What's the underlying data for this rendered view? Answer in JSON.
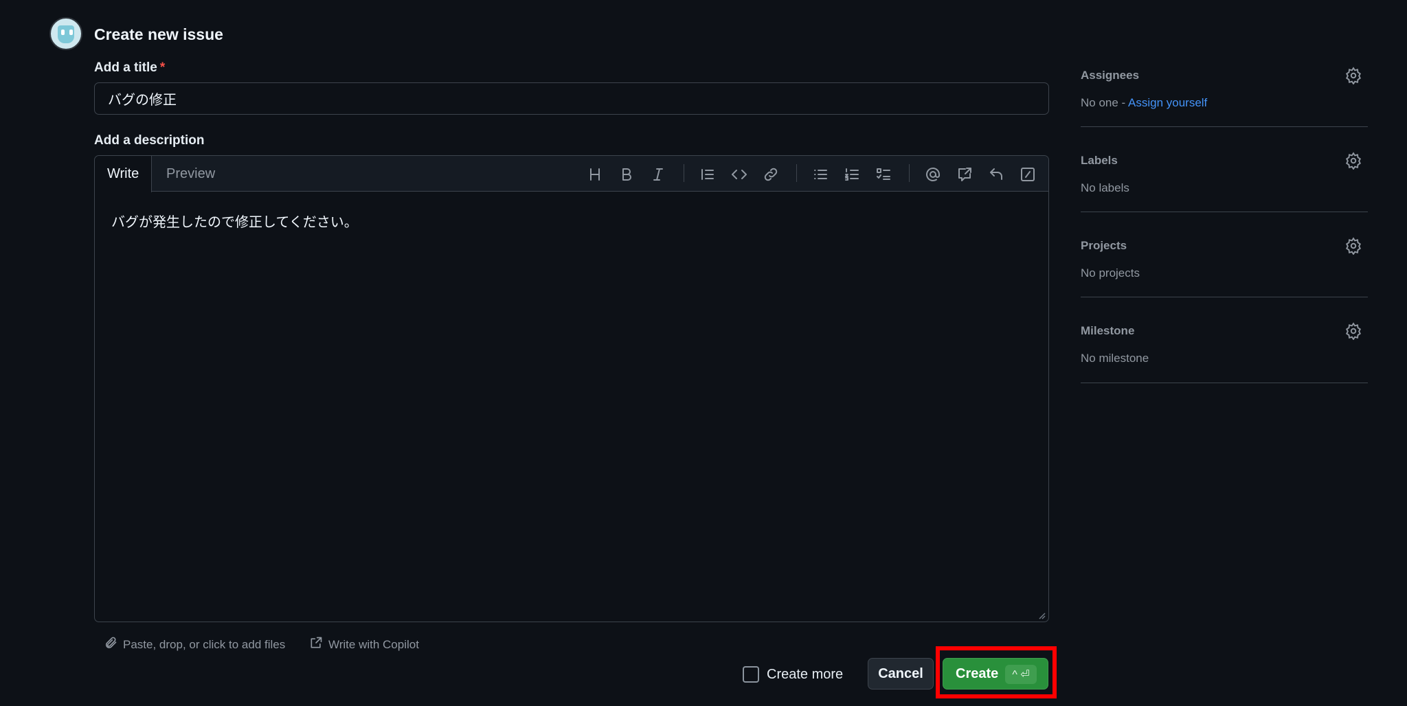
{
  "header": {
    "title": "Create new issue"
  },
  "form": {
    "title_label": "Add a title",
    "required_marker": "*",
    "title_value": "バグの修正",
    "description_label": "Add a description"
  },
  "editor": {
    "tabs": [
      {
        "label": "Write",
        "active": true
      },
      {
        "label": "Preview",
        "active": false
      }
    ],
    "toolbar": [
      {
        "icon": "heading-icon"
      },
      {
        "icon": "bold-icon"
      },
      {
        "icon": "italic-icon"
      },
      {
        "icon": "quote-icon"
      },
      {
        "icon": "code-icon"
      },
      {
        "icon": "link-icon"
      },
      {
        "icon": "unordered-list-icon"
      },
      {
        "icon": "ordered-list-icon"
      },
      {
        "icon": "task-list-icon"
      },
      {
        "icon": "mention-icon"
      },
      {
        "icon": "cross-reference-icon"
      },
      {
        "icon": "reply-icon"
      },
      {
        "icon": "slash-commands-icon"
      }
    ],
    "body": "バグが発生したので修正してください。"
  },
  "footer": {
    "attach_label": "Paste, drop, or click to add files",
    "copilot_label": "Write with Copilot",
    "create_more_label": "Create more",
    "create_more_checked": false,
    "cancel_label": "Cancel",
    "create_label": "Create",
    "create_shortcut": "^ ⏎"
  },
  "sidebar": {
    "assignees": {
      "title": "Assignees",
      "value_prefix": "No one - ",
      "link": "Assign yourself"
    },
    "labels": {
      "title": "Labels",
      "value": "No labels"
    },
    "projects": {
      "title": "Projects",
      "value": "No projects"
    },
    "milestone": {
      "title": "Milestone",
      "value": "No milestone"
    }
  },
  "colors": {
    "background": "#0d1117",
    "primary_button": "#29903b",
    "link": "#4493f8",
    "required": "#f85149",
    "highlight_box": "#ff0000"
  }
}
